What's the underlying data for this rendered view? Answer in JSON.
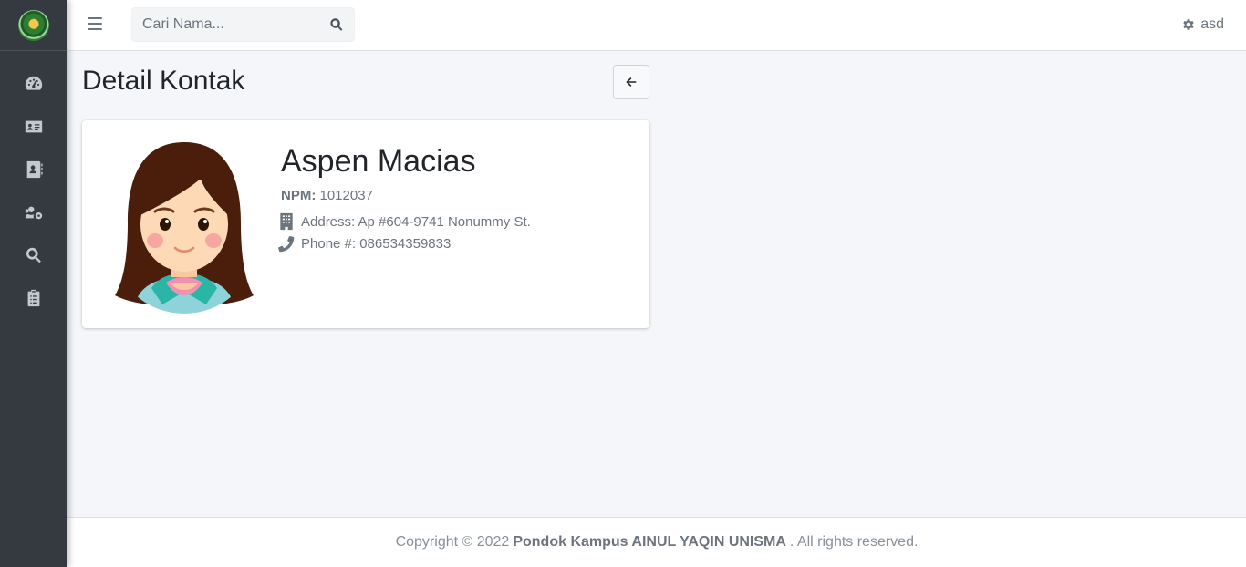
{
  "sidebar": {
    "logo": "ainul-yaqin-logo",
    "items": [
      {
        "icon": "dashboard-gauge-icon"
      },
      {
        "icon": "id-card-icon"
      },
      {
        "icon": "address-book-icon"
      },
      {
        "icon": "users-cog-icon"
      },
      {
        "icon": "search-icon"
      },
      {
        "icon": "clipboard-list-icon"
      }
    ]
  },
  "topbar": {
    "search_placeholder": "Cari Nama...",
    "user_name": "asd"
  },
  "page": {
    "title": "Detail Kontak"
  },
  "contact": {
    "name": "Aspen Macias",
    "npm_label": "NPM:",
    "npm_value": "1012037",
    "address": "Address: Ap #604-9741 Nonummy St.",
    "phone": "Phone #: 086534359833"
  },
  "footer": {
    "prefix": "Copyright © 2022",
    "org": "Pondok Kampus AINUL YAQIN UNISMA",
    "suffix": ". All rights reserved."
  },
  "colors": {
    "sidebar_bg": "#343a40",
    "content_bg": "#f4f6f9",
    "icon_gray": "#c2c7d0",
    "muted_text": "#6c757d"
  }
}
